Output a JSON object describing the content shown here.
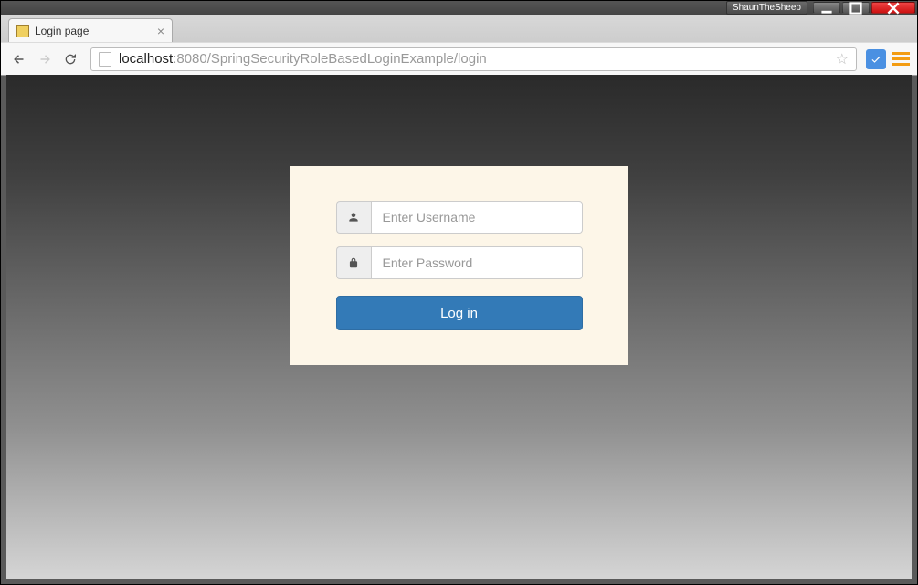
{
  "window": {
    "user_badge": "ShaunTheSheep"
  },
  "browser": {
    "tab_title": "Login page",
    "url_host": "localhost",
    "url_path": ":8080/SpringSecurityRoleBasedLoginExample/login"
  },
  "login": {
    "username_placeholder": "Enter Username",
    "username_value": "",
    "password_placeholder": "Enter Password",
    "password_value": "",
    "submit_label": "Log in"
  }
}
